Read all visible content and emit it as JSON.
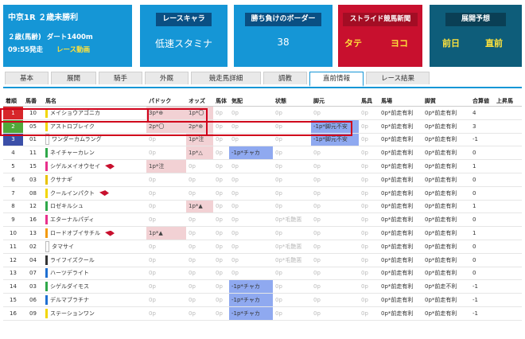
{
  "race": {
    "title": "中京1R ２歳未勝利",
    "class": "２歳(馬齢)",
    "distance": "ダート1400m",
    "start": "09:55発走",
    "video": "レース動画"
  },
  "panels": {
    "character": {
      "header": "レースキャラ",
      "value": "低速スタミナ"
    },
    "border": {
      "header": "勝ち負けのボーダー",
      "value": "38"
    },
    "stride": {
      "header": "ストライド競馬新聞",
      "left": "タテ",
      "right": "ヨコ"
    },
    "tenkai": {
      "header": "展開予想",
      "left": "前日",
      "right": "直前"
    }
  },
  "tabs": [
    "基本",
    "展開",
    "騎手",
    "外厩",
    "競走馬詳細",
    "調教",
    "直前情報",
    "レース結果"
  ],
  "active_tab": "直前情報",
  "columns": [
    "着順",
    "馬番",
    "馬名",
    "パドック",
    "オッズ",
    "馬体",
    "気配",
    "状態",
    "脚元",
    "馬具",
    "馬場",
    "脚質",
    "合算値",
    "上昇馬"
  ],
  "colors": {
    "panel_blue": "#1596d6",
    "panel_red": "#c8102e",
    "panel_teal": "#0e5d7a",
    "pink_cell": "#f2d1d4",
    "blue_cell": "#8fa9f0",
    "highlight": "#d0021b"
  },
  "rows": [
    {
      "rank": "1",
      "rank_bg": "#d7262a",
      "num": "10",
      "waku_color": "#f2d600",
      "name": "メイショウアゴニカ",
      "flag": false,
      "paddock": "3p*⊕",
      "paddock_style": "pink",
      "odds": "1p*〇",
      "odds_style": "pink",
      "body": "0p",
      "kehai": "0p",
      "kehai_style": "dim",
      "state": "0p",
      "ashimoto": "0p",
      "ashimoto_style": "dim",
      "bagu": "0p",
      "baba": "0p*前走有利",
      "kyakushitsu": "0p*前走有利",
      "total": "4"
    },
    {
      "rank": "2",
      "rank_bg": "#51a83a",
      "num": "05",
      "waku_color": "#f2d600",
      "name": "アストロブレイク",
      "flag": false,
      "paddock": "2p*〇",
      "paddock_style": "pink",
      "odds": "2p*⊕",
      "odds_style": "pink",
      "body": "0p",
      "kehai": "0p",
      "kehai_style": "dim",
      "state": "0p",
      "ashimoto": "-1p*脚元不安",
      "ashimoto_style": "blue",
      "bagu": "0p",
      "baba": "0p*前走有利",
      "kyakushitsu": "0p*前走有利",
      "total": "3"
    },
    {
      "rank": "3",
      "rank_bg": "#3b4fa8",
      "num": "01",
      "waku_color": "#ffffff",
      "name": "ワンダーカムラング",
      "flag": false,
      "paddock": "0p",
      "paddock_style": "dim",
      "odds": "1p*注",
      "odds_style": "pink",
      "body": "0p",
      "kehai": "0p",
      "kehai_style": "dim",
      "state": "0p",
      "ashimoto": "-1p*脚元不安",
      "ashimoto_style": "blue",
      "bagu": "0p",
      "baba": "0p*前走有利",
      "kyakushitsu": "0p*前走有利",
      "total": "-1"
    },
    {
      "rank": "4",
      "rank_bg": "",
      "num": "11",
      "waku_color": "#2fa84a",
      "name": "ネイチャーカレン",
      "flag": false,
      "paddock": "0p",
      "paddock_style": "dim",
      "odds": "1p*△",
      "odds_style": "pink",
      "body": "0p",
      "kehai": "-1p*チャカ",
      "kehai_style": "blue",
      "state": "0p",
      "ashimoto": "0p",
      "ashimoto_style": "dim",
      "bagu": "0p",
      "baba": "0p*前走有利",
      "kyakushitsu": "0p*前走有利",
      "total": "0"
    },
    {
      "rank": "5",
      "rank_bg": "",
      "num": "15",
      "waku_color": "#e8308c",
      "name": "シゲルメイオウセイ",
      "flag": true,
      "paddock": "1p*注",
      "paddock_style": "pink",
      "odds": "0p",
      "odds_style": "dim",
      "body": "0p",
      "kehai": "0p",
      "kehai_style": "dim",
      "state": "0p",
      "ashimoto": "0p",
      "ashimoto_style": "dim",
      "bagu": "0p",
      "baba": "0p*前走有利",
      "kyakushitsu": "0p*前走有利",
      "total": "1"
    },
    {
      "rank": "6",
      "rank_bg": "",
      "num": "03",
      "waku_color": "#e8c200",
      "name": "クサナギ",
      "flag": false,
      "paddock": "0p",
      "paddock_style": "dim",
      "odds": "0p",
      "odds_style": "dim",
      "body": "0p",
      "kehai": "0p",
      "kehai_style": "dim",
      "state": "0p",
      "ashimoto": "0p",
      "ashimoto_style": "dim",
      "bagu": "0p",
      "baba": "0p*前走有利",
      "kyakushitsu": "0p*前走有利",
      "total": "0"
    },
    {
      "rank": "7",
      "rank_bg": "",
      "num": "08",
      "waku_color": "#f2d600",
      "name": "クールインパクト",
      "flag": true,
      "paddock": "0p",
      "paddock_style": "dim",
      "odds": "0p",
      "odds_style": "dim",
      "body": "0p",
      "kehai": "0p",
      "kehai_style": "dim",
      "state": "0p",
      "ashimoto": "0p",
      "ashimoto_style": "dim",
      "bagu": "0p",
      "baba": "0p*前走有利",
      "kyakushitsu": "0p*前走有利",
      "total": "0"
    },
    {
      "rank": "8",
      "rank_bg": "",
      "num": "12",
      "waku_color": "#2fa84a",
      "name": "ロゼキルシュ",
      "flag": false,
      "paddock": "0p",
      "paddock_style": "dim",
      "odds": "1p*▲",
      "odds_style": "pink",
      "body": "0p",
      "kehai": "0p",
      "kehai_style": "dim",
      "state": "0p",
      "ashimoto": "0p",
      "ashimoto_style": "dim",
      "bagu": "0p",
      "baba": "0p*前走有利",
      "kyakushitsu": "0p*前走有利",
      "total": "1"
    },
    {
      "rank": "9",
      "rank_bg": "",
      "num": "16",
      "waku_color": "#e8308c",
      "name": "エターナルパディ",
      "flag": false,
      "paddock": "0p",
      "paddock_style": "dim",
      "odds": "0p",
      "odds_style": "dim",
      "body": "0p",
      "kehai": "0p",
      "kehai_style": "dim",
      "state": "0p*毛艶悪",
      "ashimoto": "0p",
      "ashimoto_style": "dim",
      "bagu": "0p",
      "baba": "0p*前走有利",
      "kyakushitsu": "0p*前走有利",
      "total": "0"
    },
    {
      "rank": "10",
      "rank_bg": "",
      "num": "13",
      "waku_color": "#f29a0d",
      "name": "ロードオブイサチル",
      "flag": true,
      "paddock": "1p*▲",
      "paddock_style": "pink",
      "odds": "0p",
      "odds_style": "dim",
      "body": "0p",
      "kehai": "0p",
      "kehai_style": "dim",
      "state": "0p",
      "ashimoto": "0p",
      "ashimoto_style": "dim",
      "bagu": "0p",
      "baba": "0p*前走有利",
      "kyakushitsu": "0p*前走有利",
      "total": "1"
    },
    {
      "rank": "11",
      "rank_bg": "",
      "num": "02",
      "waku_color": "#ffffff",
      "name": "タマサイ",
      "flag": false,
      "paddock": "0p",
      "paddock_style": "dim",
      "odds": "0p",
      "odds_style": "dim",
      "body": "0p",
      "kehai": "0p",
      "kehai_style": "dim",
      "state": "0p*毛艶悪",
      "ashimoto": "0p",
      "ashimoto_style": "dim",
      "bagu": "0p",
      "baba": "0p*前走有利",
      "kyakushitsu": "0p*前走有利",
      "total": "0"
    },
    {
      "rank": "12",
      "rank_bg": "",
      "num": "04",
      "waku_color": "#333333",
      "name": "ライフイズクール",
      "flag": false,
      "paddock": "0p",
      "paddock_style": "dim",
      "odds": "0p",
      "odds_style": "dim",
      "body": "0p",
      "kehai": "0p",
      "kehai_style": "dim",
      "state": "0p*毛艶悪",
      "ashimoto": "0p",
      "ashimoto_style": "dim",
      "bagu": "0p",
      "baba": "0p*前走有利",
      "kyakushitsu": "0p*前走有利",
      "total": "0"
    },
    {
      "rank": "13",
      "rank_bg": "",
      "num": "07",
      "waku_color": "#1f6fd1",
      "name": "ハーツデライト",
      "flag": false,
      "paddock": "0p",
      "paddock_style": "dim",
      "odds": "0p",
      "odds_style": "dim",
      "body": "0p",
      "kehai": "0p",
      "kehai_style": "dim",
      "state": "0p",
      "ashimoto": "0p",
      "ashimoto_style": "dim",
      "bagu": "0p",
      "baba": "0p*前走有利",
      "kyakushitsu": "0p*前走有利",
      "total": "0"
    },
    {
      "rank": "14",
      "rank_bg": "",
      "num": "03",
      "waku_color": "#2fa84a",
      "name": "シゲルダイモス",
      "flag": false,
      "paddock": "0p",
      "paddock_style": "dim",
      "odds": "0p",
      "odds_style": "dim",
      "body": "0p",
      "kehai": "-1p*チャカ",
      "kehai_style": "blue",
      "state": "0p",
      "ashimoto": "0p",
      "ashimoto_style": "dim",
      "bagu": "0p",
      "baba": "0p*前走有利",
      "kyakushitsu": "0p*前走不利",
      "total": "-1"
    },
    {
      "rank": "15",
      "rank_bg": "",
      "num": "06",
      "waku_color": "#1f6fd1",
      "name": "デルマブラチナ",
      "flag": false,
      "paddock": "0p",
      "paddock_style": "dim",
      "odds": "0p",
      "odds_style": "dim",
      "body": "0p",
      "kehai": "-1p*チャカ",
      "kehai_style": "blue",
      "state": "0p",
      "ashimoto": "0p",
      "ashimoto_style": "dim",
      "bagu": "0p",
      "baba": "0p*前走有利",
      "kyakushitsu": "0p*前走有利",
      "total": "-1"
    },
    {
      "rank": "16",
      "rank_bg": "",
      "num": "09",
      "waku_color": "#f2d600",
      "name": "ステーションワン",
      "flag": false,
      "paddock": "0p",
      "paddock_style": "dim",
      "odds": "0p",
      "odds_style": "dim",
      "body": "0p",
      "kehai": "-1p*チャカ",
      "kehai_style": "blue",
      "state": "0p",
      "ashimoto": "0p",
      "ashimoto_style": "dim",
      "bagu": "0p",
      "baba": "0p*前走有利",
      "kyakushitsu": "0p*前走有利",
      "total": "-1"
    }
  ]
}
